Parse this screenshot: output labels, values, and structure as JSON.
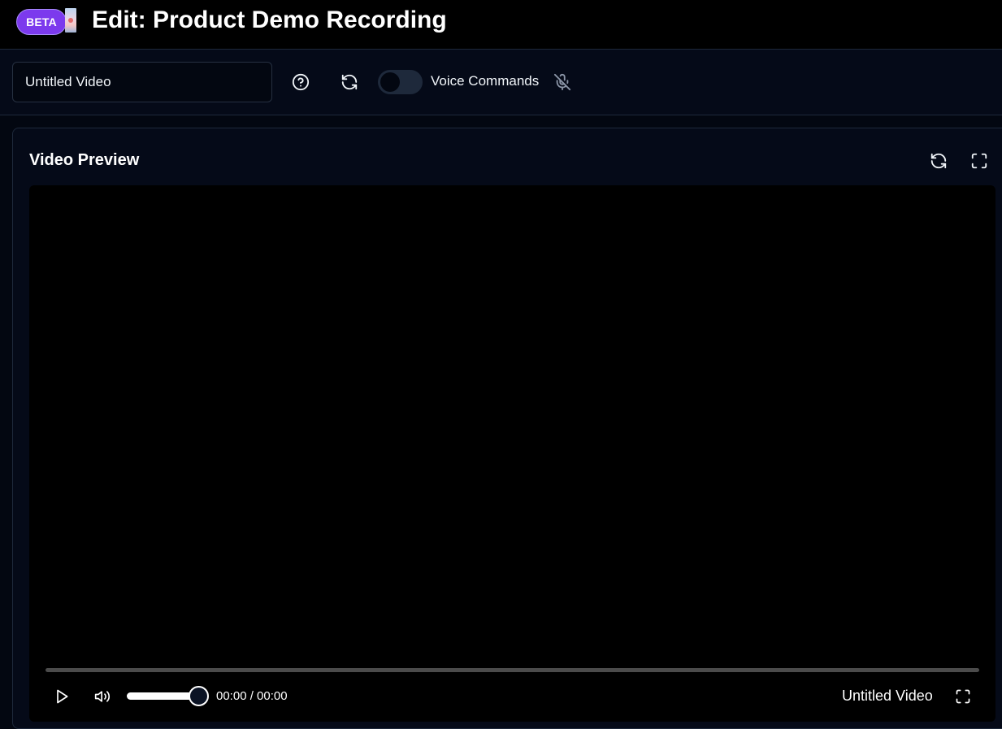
{
  "header": {
    "badge": "BETA",
    "title": "Edit: Product Demo Recording"
  },
  "toolbar": {
    "name_value": "Untitled Video",
    "voice_label": "Voice Commands",
    "voice_enabled": false
  },
  "preview": {
    "title": "Video Preview"
  },
  "player": {
    "time_display": "00:00 / 00:00",
    "video_name": "Untitled Video",
    "progress_fraction": 0,
    "volume_fraction": 0.92
  },
  "colors": {
    "badge_bg": "#7c3aed",
    "page_bg": "#030711",
    "panel_bg": "#050a18",
    "border": "#1e293b"
  },
  "icons": {
    "help": "help-circle-icon",
    "refresh": "refresh-icon",
    "mic_off": "mic-off-icon",
    "fullscreen": "maximize-icon",
    "play": "play-icon",
    "volume": "volume-icon"
  }
}
